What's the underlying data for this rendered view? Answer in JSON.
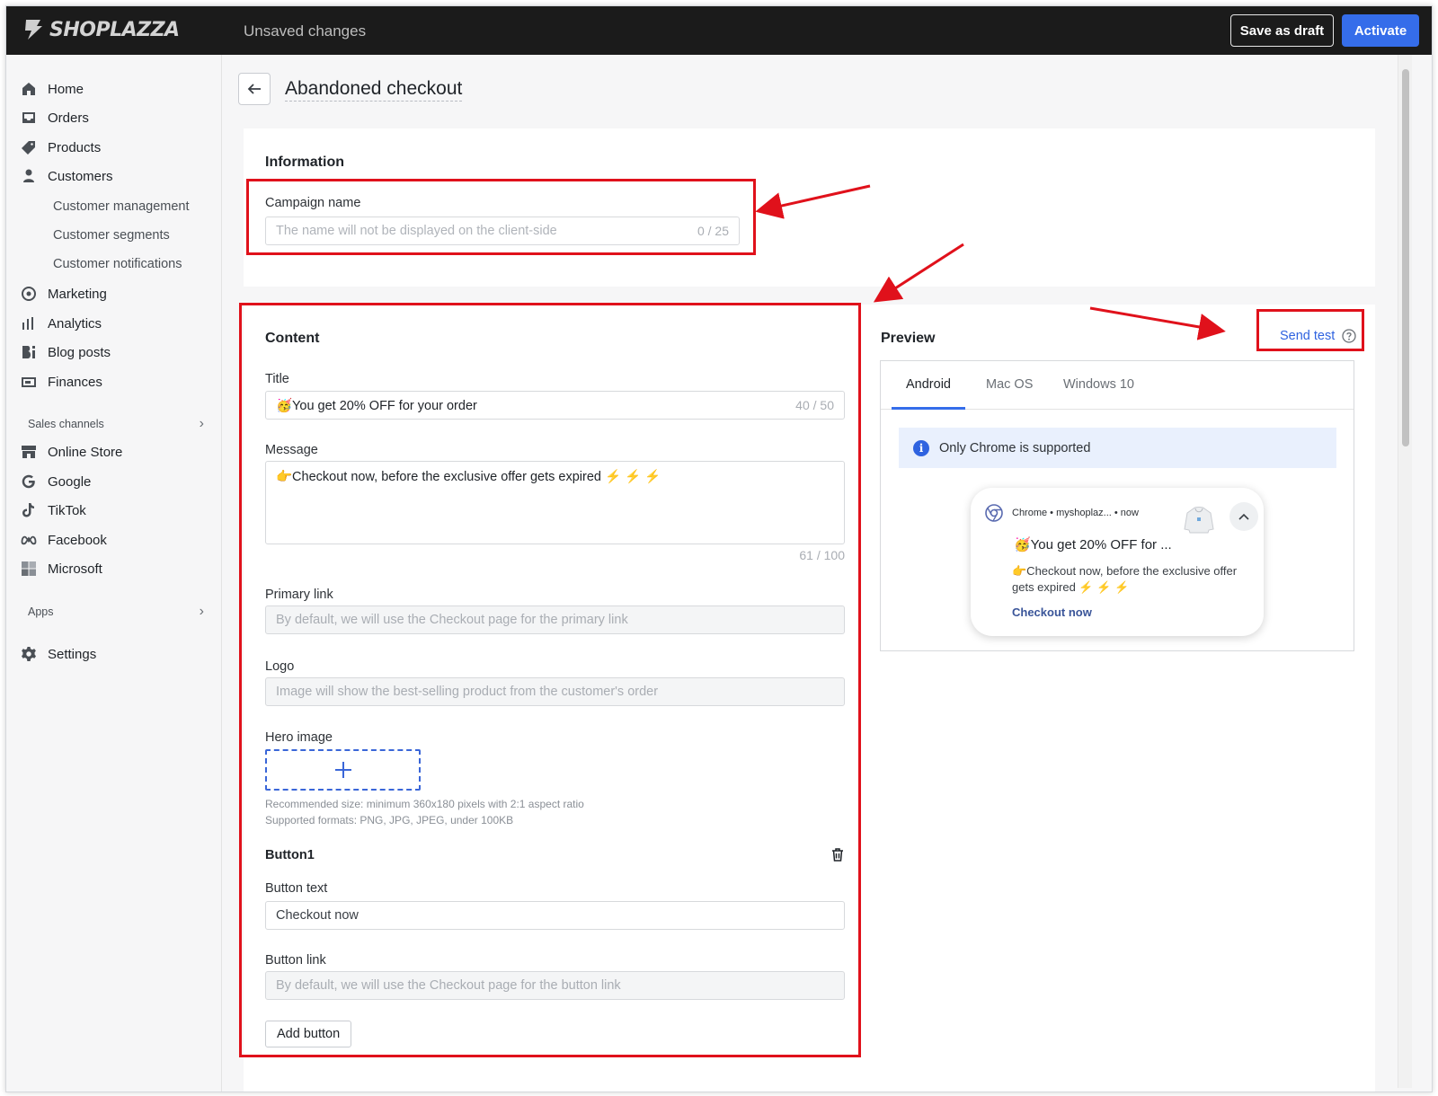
{
  "app": {
    "brand": "SHOPLAZZA",
    "status": "Unsaved changes"
  },
  "toolbar": {
    "draft_label": "Save as draft",
    "activate_label": "Activate"
  },
  "sidebar": {
    "items": [
      {
        "label": "Home",
        "icon": "home-icon"
      },
      {
        "label": "Orders",
        "icon": "inbox-icon"
      },
      {
        "label": "Products",
        "icon": "tag-icon"
      },
      {
        "label": "Customers",
        "icon": "person-icon"
      }
    ],
    "customer_sub": [
      "Customer management",
      "Customer segments",
      "Customer notifications"
    ],
    "items2": [
      {
        "label": "Marketing",
        "icon": "target-icon"
      },
      {
        "label": "Analytics",
        "icon": "bar-chart-icon"
      },
      {
        "label": "Blog posts",
        "icon": "blog-icon"
      },
      {
        "label": "Finances",
        "icon": "finance-icon"
      }
    ],
    "sales_channels": "Sales channels",
    "channels": [
      {
        "label": "Online Store",
        "icon": "store-icon"
      },
      {
        "label": "Google",
        "icon": "google-icon"
      },
      {
        "label": "TikTok",
        "icon": "tiktok-icon"
      },
      {
        "label": "Facebook",
        "icon": "meta-icon"
      },
      {
        "label": "Microsoft",
        "icon": "microsoft-icon"
      }
    ],
    "apps": "Apps",
    "settings": "Settings"
  },
  "page": {
    "title": "Abandoned checkout"
  },
  "information": {
    "heading": "Information",
    "campaign_label": "Campaign name",
    "campaign_placeholder": "The name will not be displayed on the client-side",
    "campaign_counter": "0 / 25"
  },
  "content": {
    "heading": "Content",
    "title_label": "Title",
    "title_value": "🥳You get 20% OFF for your order",
    "title_counter": "40 / 50",
    "message_label": "Message",
    "message_value": "👉Checkout now, before the exclusive offer gets expired ⚡ ⚡ ⚡",
    "message_counter": "61 / 100",
    "primary_link_label": "Primary link",
    "primary_link_placeholder": "By default, we will use the Checkout page for the primary link",
    "logo_label": "Logo",
    "logo_placeholder": "Image will show the best-selling product from the customer's order",
    "hero_label": "Hero image",
    "hero_hint1": "Recommended size: minimum 360x180 pixels with 2:1 aspect ratio",
    "hero_hint2": "Supported formats: PNG, JPG, JPEG, under 100KB",
    "button1_heading": "Button1",
    "button_text_label": "Button text",
    "button_text_value": "Checkout now",
    "button_link_label": "Button link",
    "button_link_placeholder": "By default, we will use the Checkout page for the button link",
    "add_button": "Add button"
  },
  "preview": {
    "heading": "Preview",
    "send_test": "Send test",
    "tabs": [
      "Android",
      "Mac OS",
      "Windows 10"
    ],
    "notice": "Only Chrome is supported",
    "notif_source": "Chrome • myshoplaz... • now",
    "notif_title": "🥳You get 20% OFF for ...",
    "notif_message": "👉Checkout now, before the exclusive offer gets expired ⚡ ⚡ ⚡",
    "notif_action": "Checkout now"
  },
  "colors": {
    "accent": "#356dea",
    "annotation": "#e0111b",
    "topbar": "#1b1b1b"
  }
}
